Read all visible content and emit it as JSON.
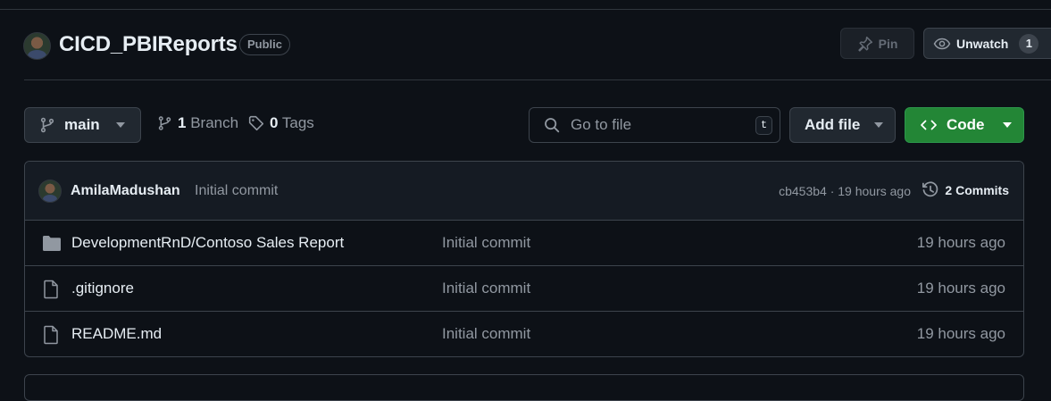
{
  "repo": {
    "name": "CICD_PBIReports",
    "visibility": "Public"
  },
  "actions": {
    "pin_label": "Pin",
    "unwatch_label": "Unwatch",
    "watch_count": "1"
  },
  "toolbar": {
    "branch": "main",
    "branch_count": "1",
    "branch_label": "Branch",
    "tag_count": "0",
    "tag_label": "Tags",
    "search_placeholder": "Go to file",
    "search_shortcut": "t",
    "add_file_label": "Add file",
    "code_label": "Code"
  },
  "latest_commit": {
    "author": "AmilaMadushan",
    "message": "Initial commit",
    "meta": "cb453b4 · 19 hours ago",
    "commits_label": "2 Commits"
  },
  "files": [
    {
      "type": "folder",
      "icon": "folder-icon",
      "name": "DevelopmentRnD/Contoso Sales Report",
      "message": "Initial commit",
      "time": "19 hours ago"
    },
    {
      "type": "file",
      "icon": "file-icon",
      "name": ".gitignore",
      "message": "Initial commit",
      "time": "19 hours ago"
    },
    {
      "type": "file",
      "icon": "file-icon",
      "name": "README.md",
      "message": "Initial commit",
      "time": "19 hours ago"
    }
  ],
  "colors": {
    "background": "#0d1117",
    "border": "#3d444d",
    "code_button": "#238636",
    "muted_text": "#9198a1"
  }
}
